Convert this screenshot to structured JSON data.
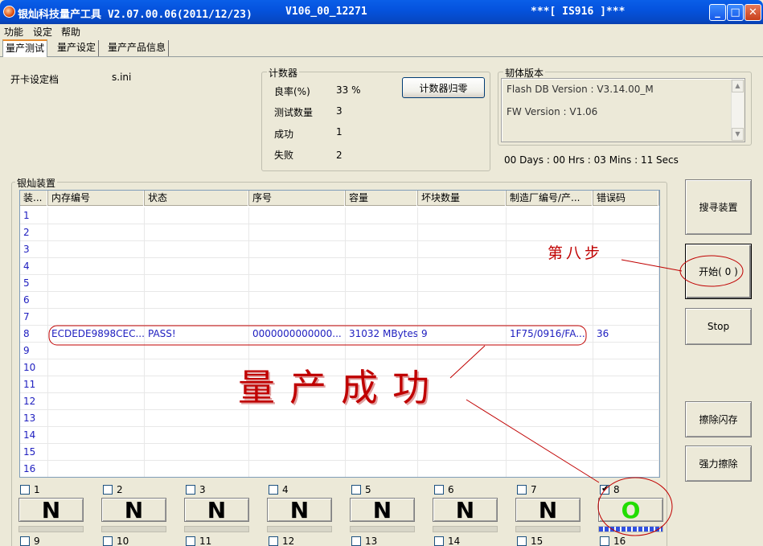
{
  "window": {
    "title": "银灿科技量产工具 V2.07.00.06(2011/12/23)",
    "version": "V106_00_12271",
    "chip": "***[ IS916 ]***"
  },
  "menu": [
    "功能",
    "设定",
    "帮助"
  ],
  "tabs": [
    "量产测试",
    "量产设定",
    "量产产品信息"
  ],
  "settings_file": {
    "label": "开卡设定档",
    "value": "s.ini"
  },
  "counter": {
    "title": "计数器",
    "yield_label": "良率(%)",
    "yield_value": "33 %",
    "tested_label": "测试数量",
    "tested_value": "3",
    "success_label": "成功",
    "success_value": "1",
    "fail_label": "失败",
    "fail_value": "2",
    "reset_button": "计数器归零"
  },
  "firmware": {
    "title": "韧体版本",
    "flash_db": "Flash DB Version :  V3.14.00_M",
    "fw": "FW Version :   V1.06"
  },
  "elapsed": "00 Days : 00 Hrs : 03 Mins : 11 Secs",
  "devices_title": "银灿装置",
  "table": {
    "headers": [
      "装...",
      "内存编号",
      "状态",
      "序号",
      "容量",
      "坏块数量",
      "制造厂编号/产...",
      "错误码"
    ],
    "rows": [
      [
        "1",
        "",
        "",
        "",
        "",
        "",
        "",
        ""
      ],
      [
        "2",
        "",
        "",
        "",
        "",
        "",
        "",
        ""
      ],
      [
        "3",
        "",
        "",
        "",
        "",
        "",
        "",
        ""
      ],
      [
        "4",
        "",
        "",
        "",
        "",
        "",
        "",
        ""
      ],
      [
        "5",
        "",
        "",
        "",
        "",
        "",
        "",
        ""
      ],
      [
        "6",
        "",
        "",
        "",
        "",
        "",
        "",
        ""
      ],
      [
        "7",
        "",
        "",
        "",
        "",
        "",
        "",
        ""
      ],
      [
        "8",
        "ECDEDE9898CEC...",
        "PASS!",
        "0000000000000...",
        "31032 MBytes",
        "9",
        "1F75/0916/FA...",
        "36"
      ],
      [
        "9",
        "",
        "",
        "",
        "",
        "",
        "",
        ""
      ],
      [
        "10",
        "",
        "",
        "",
        "",
        "",
        "",
        ""
      ],
      [
        "11",
        "",
        "",
        "",
        "",
        "",
        "",
        ""
      ],
      [
        "12",
        "",
        "",
        "",
        "",
        "",
        "",
        ""
      ],
      [
        "13",
        "",
        "",
        "",
        "",
        "",
        "",
        ""
      ],
      [
        "14",
        "",
        "",
        "",
        "",
        "",
        "",
        ""
      ],
      [
        "15",
        "",
        "",
        "",
        "",
        "",
        "",
        ""
      ],
      [
        "16",
        "",
        "",
        "",
        "",
        "",
        "",
        ""
      ]
    ]
  },
  "buttons": {
    "search": "搜寻装置",
    "start": "开始( 0 )",
    "stop": "Stop",
    "erase": "擦除闪存",
    "force_erase": "强力擦除"
  },
  "ports": [
    {
      "num": "1",
      "status": "N",
      "checked": false
    },
    {
      "num": "2",
      "status": "N",
      "checked": false
    },
    {
      "num": "3",
      "status": "N",
      "checked": false
    },
    {
      "num": "4",
      "status": "N",
      "checked": false
    },
    {
      "num": "5",
      "status": "N",
      "checked": false
    },
    {
      "num": "6",
      "status": "N",
      "checked": false
    },
    {
      "num": "7",
      "status": "N",
      "checked": false
    },
    {
      "num": "8",
      "status": "O",
      "checked": true,
      "progress": 1.0
    }
  ],
  "ports_row2": [
    "9",
    "10",
    "11",
    "12",
    "13",
    "14",
    "15",
    "16"
  ],
  "annotations": {
    "step8": "第八步",
    "success": "量产成功"
  },
  "colors": {
    "title_blue": "#0553de",
    "table_text": "#2020c0",
    "pass_green": "#22dd00",
    "annotation_red": "#c00000",
    "progress_blue": "#3050e0"
  }
}
